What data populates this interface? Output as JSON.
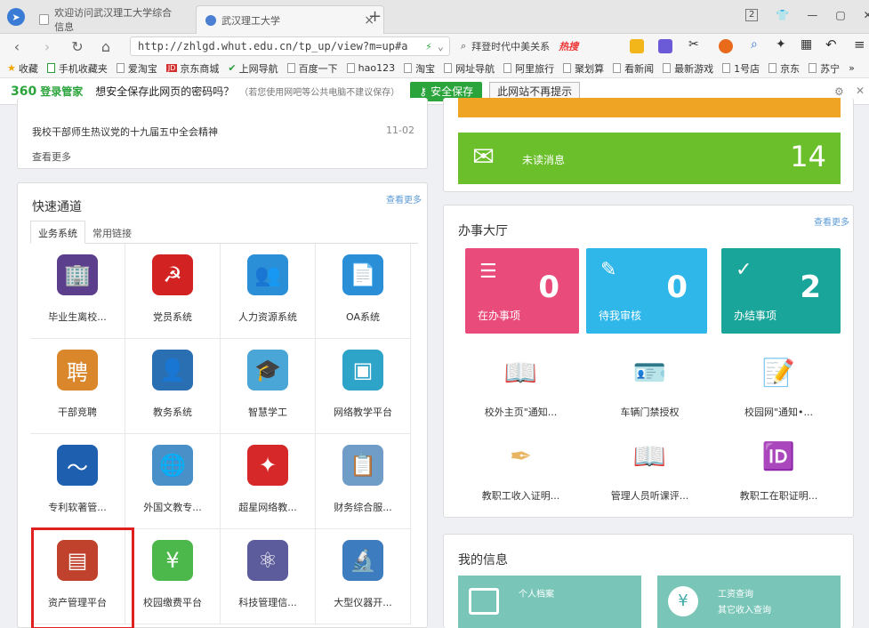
{
  "browser": {
    "tabs": [
      {
        "title": "欢迎访问武汉理工大学综合信息"
      },
      {
        "title": "武汉理工大学"
      }
    ],
    "tab_close": "×",
    "new_tab": "+",
    "window_controls": {
      "box": "2",
      "min": "—",
      "max": "▢",
      "close": "✕"
    },
    "url": "http://zhlgd.whut.edu.cn/tp_up/view?m=up#a",
    "search_text": "拜登时代中美关系",
    "hot_label": "热搜",
    "bookmarks": [
      "收藏",
      "手机收藏夹",
      "爱淘宝",
      "京东商城",
      "上网导航",
      "百度一下",
      "hao123",
      "淘宝",
      "网址导航",
      "阿里旅行",
      "聚划算",
      "看新闻",
      "最新游戏",
      "1号店",
      "京东",
      "苏宁",
      "»"
    ]
  },
  "password_bar": {
    "brand": "360",
    "brand_sub": "登录管家",
    "question": "想安全保存此网页的密码吗？",
    "note": "（若您使用网吧等公共电脑不建议保存）",
    "save_label": "安全保存",
    "never_label": "此网站不再提示"
  },
  "news": {
    "item": "我校干部师生热议党的十九届五中全会精神",
    "date": "11-02",
    "more": "查看更多"
  },
  "quick": {
    "title": "快速通道",
    "more": "查看更多",
    "tabs": [
      "业务系统",
      "常用链接"
    ],
    "tiles": [
      {
        "label": "毕业生离校...",
        "icon": "building-clock-icon",
        "color": "#5b3f8c"
      },
      {
        "label": "党员系统",
        "icon": "party-emblem-icon",
        "color": "#d32222"
      },
      {
        "label": "人力资源系统",
        "icon": "people-icon",
        "color": "#2b8fd8"
      },
      {
        "label": "OA系统",
        "icon": "document-icon",
        "color": "#2b8fd8"
      },
      {
        "label": "干部竞聘",
        "icon": "recruit-icon",
        "color": "#d9872a"
      },
      {
        "label": "教务系统",
        "icon": "teacher-icon",
        "color": "#2b6fb3"
      },
      {
        "label": "智慧学工",
        "icon": "graduation-cap-icon",
        "color": "#4aa6d6"
      },
      {
        "label": "网络教学平台",
        "icon": "screen-icon",
        "color": "#2fa4c9"
      },
      {
        "label": "专利软著管...",
        "icon": "swoosh-icon",
        "color": "#1f5fb0"
      },
      {
        "label": "外国文教专...",
        "icon": "globe-icon",
        "color": "#4a90c8"
      },
      {
        "label": "超星网络教...",
        "icon": "chaoxing-icon",
        "color": "#d62828"
      },
      {
        "label": "财务综合服...",
        "icon": "finance-doc-icon",
        "color": "#6f9dc7"
      },
      {
        "label": "资产管理平台",
        "icon": "wallet-icon",
        "color": "#c0412c"
      },
      {
        "label": "校园缴费平台",
        "icon": "yuan-icon",
        "color": "#4cb84c"
      },
      {
        "label": "科技管理信...",
        "icon": "atom-icon",
        "color": "#5c5c9c"
      },
      {
        "label": "大型仪器开...",
        "icon": "microscope-icon",
        "color": "#3d7dbf"
      }
    ]
  },
  "messages": {
    "label": "未读消息",
    "count": "14"
  },
  "hall": {
    "title": "办事大厅",
    "more": "查看更多",
    "stats": [
      {
        "label": "在办事项",
        "count": "0",
        "color": "#e94b7b"
      },
      {
        "label": "待我审核",
        "count": "0",
        "color": "#2fb7ea"
      },
      {
        "label": "办结事项",
        "count": "2",
        "color": "#1aa59a"
      }
    ],
    "items": [
      {
        "label": "校外主页\"通知...",
        "icon": "book-clock-icon"
      },
      {
        "label": "车辆门禁授权",
        "icon": "id-person-icon"
      },
      {
        "label": "校园网\"通知•...",
        "icon": "notepad-icon"
      },
      {
        "label": "教职工收入证明...",
        "icon": "quill-doc-icon"
      },
      {
        "label": "管理人员听课评...",
        "icon": "book-clock-icon"
      },
      {
        "label": "教职工在职证明...",
        "icon": "id-card-icon"
      }
    ]
  },
  "myinfo": {
    "title": "我的信息",
    "cards": [
      {
        "label": "个人档案"
      },
      {
        "label": "工资查询",
        "sub": "其它收入查询"
      }
    ]
  }
}
